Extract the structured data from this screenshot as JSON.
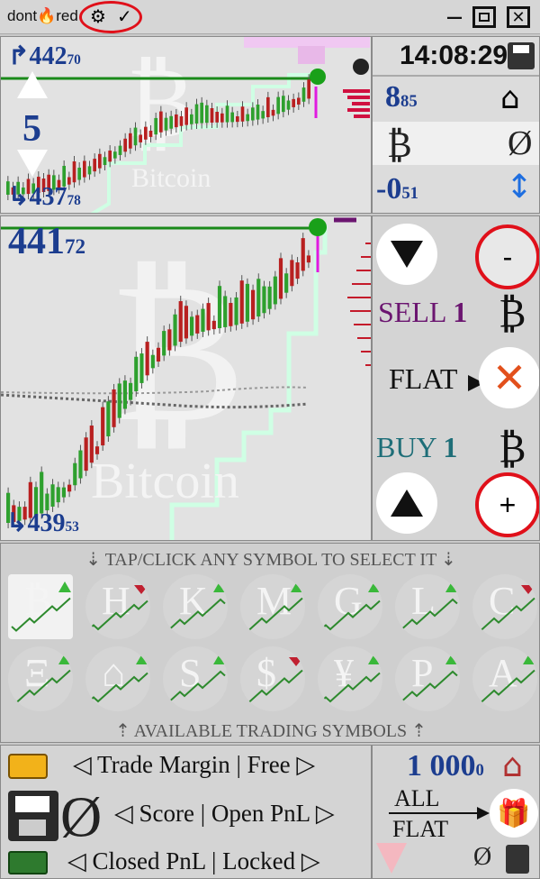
{
  "titlebar": {
    "app_name": "dont",
    "app_name_tail": "red",
    "check_mark": "✓",
    "icons": [
      "flame-icon",
      "gear-icon",
      "maximize-icon",
      "close-icon"
    ]
  },
  "top_chart": {
    "price_high_main": "442",
    "price_high_frac": "70",
    "price_low_main": "437",
    "price_low_frac": "78",
    "interval": "5",
    "symbol_name": "Bitcoin"
  },
  "info": {
    "time": "14:08:29",
    "balance_main": "8",
    "balance_frac": "85",
    "coin": "₿",
    "empty_set": "Ø",
    "change_main": "-0",
    "change_frac": "51"
  },
  "main_chart": {
    "price_top_main": "441",
    "price_top_frac": "72",
    "price_low_main": "439",
    "price_low_frac": "53",
    "symbol_name": "Bitcoin"
  },
  "trade": {
    "sell_label": "SELL",
    "sell_qty": "1",
    "flat_label": "FLAT",
    "buy_label": "BUY",
    "buy_qty": "1",
    "coin": "₿",
    "minus_label": "-",
    "plus_label": "+"
  },
  "symbols": {
    "header": "⇣ TAP/CLICK ANY SYMBOL TO SELECT IT ⇣",
    "footer": "⇡ AVAILABLE TRADING SYMBOLS ⇡",
    "row1": [
      "₿",
      "H",
      "K",
      "M",
      "G",
      "L",
      "C"
    ],
    "row2": [
      "Ξ",
      "⌂",
      "S",
      "$",
      "¥",
      "P",
      "A"
    ]
  },
  "bottom": {
    "margin_label": "◁ Trade Margin | Free ▷",
    "score_label": "◁ Score | Open PnL ▷",
    "closed_label": "◁ Closed PnL | Locked ▷",
    "empty_set": "Ø",
    "cash_main": "1 000",
    "cash_frac": "0",
    "all_label": "ALL",
    "flat_label": "FLAT",
    "empty_set_small": "Ø"
  },
  "colors": {
    "accent_red": "#e0101a",
    "price_blue": "#1c3d8f",
    "sell_purple": "#6b1570",
    "buy_teal": "#1e6e78",
    "candle_green": "#2ea02e",
    "candle_red": "#b82020"
  }
}
